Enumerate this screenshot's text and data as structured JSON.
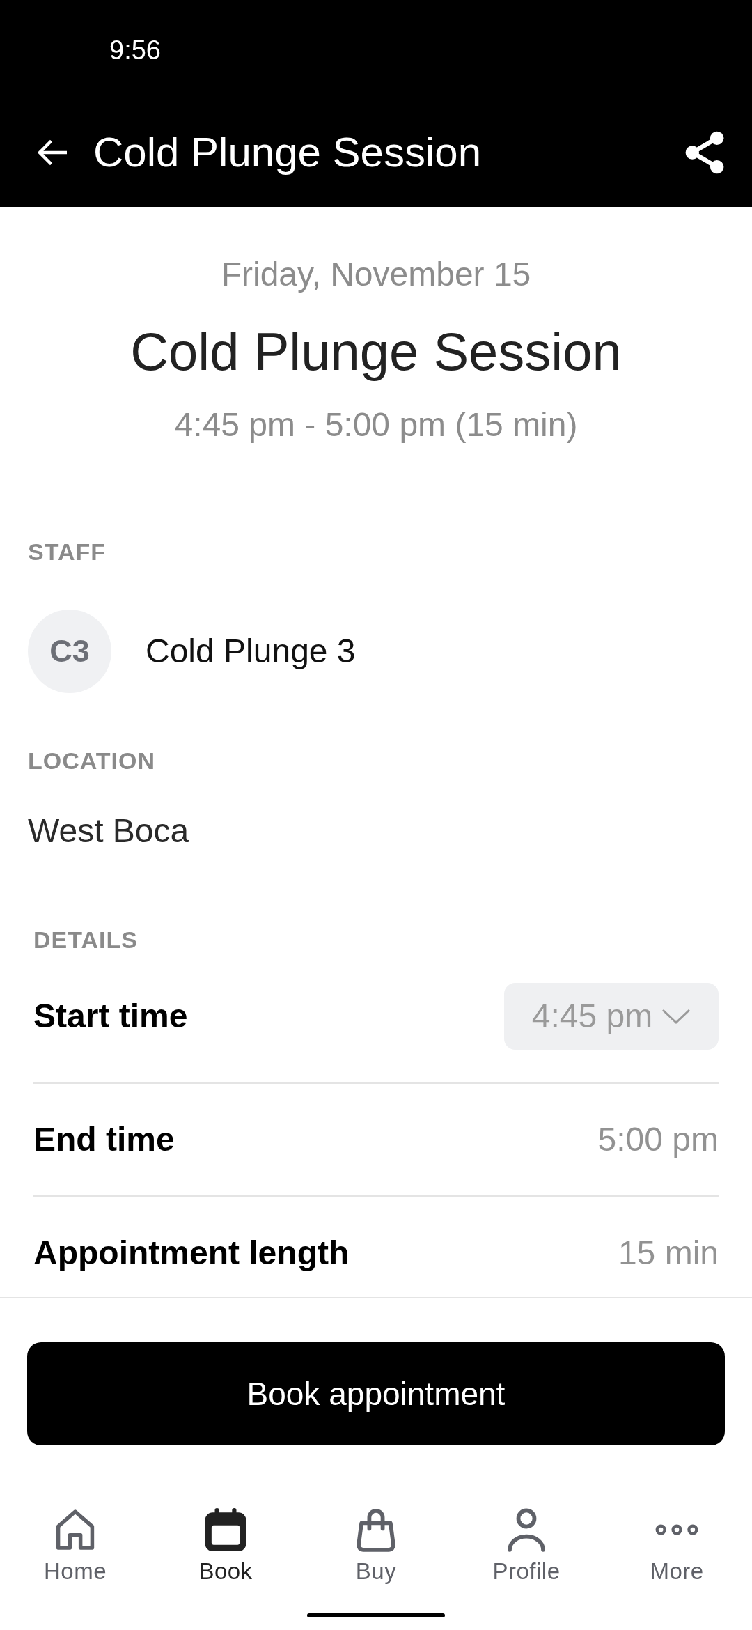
{
  "status_bar": {
    "time": "9:56"
  },
  "app_bar": {
    "title": "Cold Plunge Session"
  },
  "summary": {
    "date": "Friday, November 15",
    "title": "Cold Plunge Session",
    "time_range": "4:45 pm - 5:00 pm (15 min)"
  },
  "staff": {
    "heading": "STAFF",
    "initials": "C3",
    "name": "Cold Plunge 3"
  },
  "location": {
    "heading": "LOCATION",
    "name": "West Boca"
  },
  "details": {
    "heading": "DETAILS",
    "rows": [
      {
        "kind": "dropdown",
        "label": "Start time",
        "value": "4:45 pm"
      },
      {
        "kind": "text",
        "label": "End time",
        "value": "5:00 pm"
      },
      {
        "kind": "text",
        "label": "Appointment length",
        "value": "15 min"
      }
    ]
  },
  "book_button": {
    "label": "Book appointment"
  },
  "bottom_nav": [
    {
      "label": "Home",
      "selected": false
    },
    {
      "label": "Book",
      "selected": true
    },
    {
      "label": "Buy",
      "selected": false
    },
    {
      "label": "Profile",
      "selected": false
    },
    {
      "label": "More",
      "selected": false
    }
  ]
}
